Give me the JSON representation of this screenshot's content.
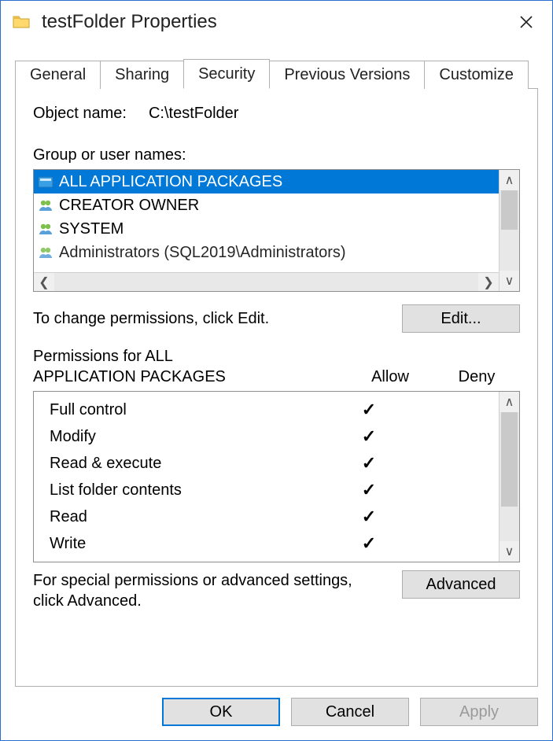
{
  "window": {
    "title": "testFolder Properties"
  },
  "tabs": {
    "general": "General",
    "sharing": "Sharing",
    "security": "Security",
    "previous": "Previous Versions",
    "customize": "Customize"
  },
  "object": {
    "label": "Object name:",
    "value": "C:\\testFolder"
  },
  "groups": {
    "label": "Group or user names:",
    "items": [
      {
        "icon": "package-icon",
        "name": "ALL APPLICATION PACKAGES",
        "selected": true
      },
      {
        "icon": "users-icon",
        "name": "CREATOR OWNER",
        "selected": false
      },
      {
        "icon": "users-icon",
        "name": "SYSTEM",
        "selected": false
      },
      {
        "icon": "users-icon",
        "name": "Administrators (SQL2019\\Administrators)",
        "selected": false
      }
    ]
  },
  "edit": {
    "hint": "To change permissions, click Edit.",
    "button": "Edit..."
  },
  "permissions": {
    "title_line1": "Permissions for ALL",
    "title_line2": "APPLICATION PACKAGES",
    "col_allow": "Allow",
    "col_deny": "Deny",
    "rows": [
      {
        "name": "Full control",
        "allow": true,
        "deny": false
      },
      {
        "name": "Modify",
        "allow": true,
        "deny": false
      },
      {
        "name": "Read & execute",
        "allow": true,
        "deny": false
      },
      {
        "name": "List folder contents",
        "allow": true,
        "deny": false
      },
      {
        "name": "Read",
        "allow": true,
        "deny": false
      },
      {
        "name": "Write",
        "allow": true,
        "deny": false
      }
    ]
  },
  "advanced": {
    "hint": "For special permissions or advanced settings, click Advanced.",
    "button": "Advanced"
  },
  "footer": {
    "ok": "OK",
    "cancel": "Cancel",
    "apply": "Apply"
  }
}
